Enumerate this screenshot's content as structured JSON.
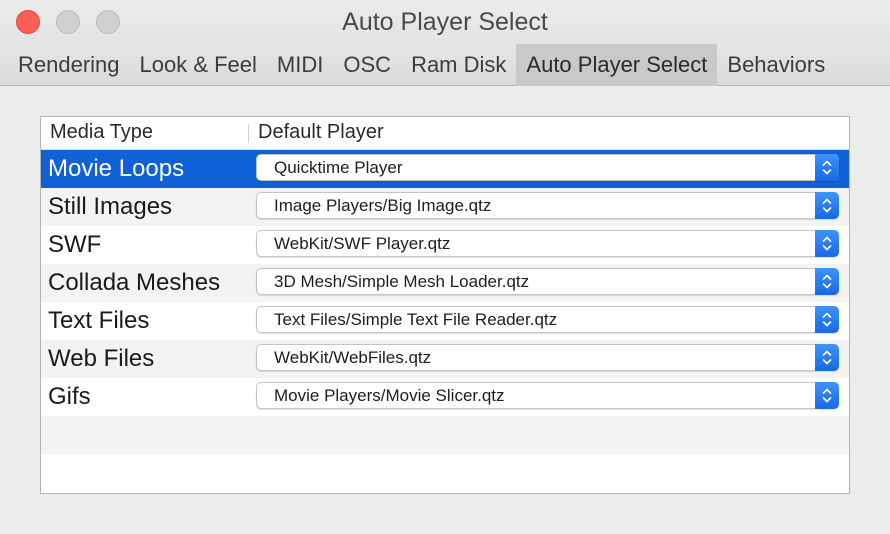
{
  "window": {
    "title": "Auto Player Select"
  },
  "tabs": [
    {
      "label": "Rendering"
    },
    {
      "label": "Look & Feel"
    },
    {
      "label": "MIDI"
    },
    {
      "label": "OSC"
    },
    {
      "label": "Ram Disk"
    },
    {
      "label": "Auto Player Select",
      "active": true
    },
    {
      "label": "Behaviors"
    }
  ],
  "table": {
    "columns": {
      "media_type": "Media Type",
      "default_player": "Default Player"
    },
    "rows": [
      {
        "media_type": "Movie Loops",
        "player": "Quicktime Player"
      },
      {
        "media_type": "Still Images",
        "player": "Image Players/Big Image.qtz"
      },
      {
        "media_type": "SWF",
        "player": "WebKit/SWF Player.qtz"
      },
      {
        "media_type": "Collada Meshes",
        "player": "3D Mesh/Simple Mesh Loader.qtz"
      },
      {
        "media_type": "Text Files",
        "player": "Text Files/Simple Text File Reader.qtz"
      },
      {
        "media_type": "Web Files",
        "player": "WebKit/WebFiles.qtz"
      },
      {
        "media_type": "Gifs",
        "player": "Movie Players/Movie Slicer.qtz"
      }
    ]
  },
  "colors": {
    "selection": "#1260d5",
    "close_button": "#fd5f57",
    "stepper": "#1769e6"
  },
  "icons": {
    "stepper": "up-down-chevron-icon"
  }
}
